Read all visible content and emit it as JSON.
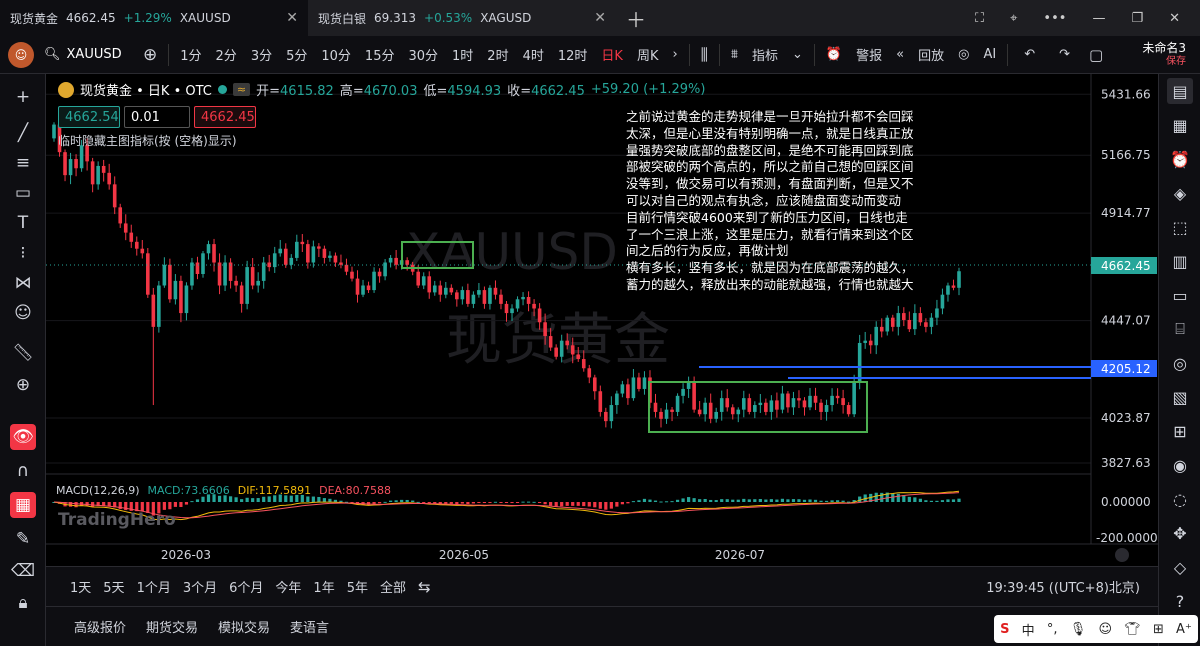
{
  "tabs": [
    {
      "title": "现货黄金",
      "price": "4662.45",
      "change": "+1.29%",
      "symbol": "XAUUSD"
    },
    {
      "title": "现货白银",
      "price": "69.313",
      "change": "+0.53%",
      "symbol": "XAGUSD"
    }
  ],
  "toolbar": {
    "symbol": "XAUUSD",
    "intervals": [
      "1分",
      "2分",
      "3分",
      "5分",
      "10分",
      "15分",
      "30分",
      "1时",
      "2时",
      "4时",
      "12时",
      "日K",
      "周K"
    ],
    "selected_interval": "日K",
    "indicators_label": "指标",
    "alert_label": "警报",
    "replay_label": "回放",
    "ai_label": "AI",
    "layout_name": "未命名3",
    "save_status": "保存"
  },
  "legend": {
    "title": "现货黄金 • 日K • OTC",
    "open_label": "开",
    "open": "4615.82",
    "high_label": "高",
    "high": "4670.03",
    "low_label": "低",
    "low": "4594.93",
    "close_label": "收",
    "close": "4662.45",
    "change": "+59.20 (+1.29%)"
  },
  "trade": {
    "bid": "4662.54",
    "qty": "0.01",
    "ask": "4662.45"
  },
  "hint": "临时隐藏主图指标(按 (空格)显示)",
  "watermark": {
    "symbol": "XAUUSD",
    "name": "现货黄金"
  },
  "note": {
    "p1": "之前说过黄金的走势规律是一旦开始拉升都不会回踩太深，但是心里没有特别明确一点，就是日线真正放量强势突破底部的盘整区间，是绝不可能再回踩到底部被突破的两个高点的，所以之前自己想的回踩区间没等到，做交易可以有预测，有盘面判断，但是又不可以对自己的观点有执念，应该随盘面变动而变动",
    "p2": "目前行情突破4600来到了新的压力区间，日线也走了一个三浪上涨，这里是压力，就看行情来到这个区间之后的行为反应，再做计划",
    "p3": "横有多长，竖有多长，就是因为在底部震荡的越久，蓄力的越久，释放出来的动能就越强，行情也就越大"
  },
  "price_axis": {
    "labels": [
      "5431.66",
      "5166.75",
      "4914.77",
      "4447.07",
      "4023.87",
      "3827.63"
    ],
    "last_price": "4662.45",
    "line_price": "4205.12"
  },
  "macd": {
    "label": "MACD(12,26,9)",
    "macd_label": "MACD:73.6606",
    "dif_label": "DIF:117.5891",
    "dea_label": "DEA:80.7588",
    "axis": [
      "0.00000",
      "-200.00000"
    ]
  },
  "time_axis": [
    "2026-03",
    "2026-05",
    "2026-07"
  ],
  "brand": "TradingHero",
  "ranges": [
    "1天",
    "5天",
    "1个月",
    "3个月",
    "6个月",
    "今年",
    "1年",
    "5年",
    "全部"
  ],
  "clock": "19:39:45 ((UTC+8)北京)",
  "panels": [
    "高级报价",
    "期货交易",
    "模拟交易",
    "麦语言"
  ],
  "ime": {
    "logo": "S",
    "lang": "中"
  },
  "colors": {
    "up": "#26a69a",
    "down": "#f23645",
    "box": "#4caf50",
    "hline": "#2962ff",
    "accent": "#f23645"
  },
  "chart_data": {
    "type": "candlestick",
    "y_range": [
      3780,
      5520
    ],
    "closes": [
      5300,
      5180,
      5080,
      5150,
      5110,
      5210,
      5140,
      5040,
      5120,
      5090,
      5040,
      4940,
      4870,
      4830,
      4790,
      4760,
      4740,
      4560,
      4420,
      4600,
      4690,
      4540,
      4620,
      4480,
      4600,
      4700,
      4650,
      4740,
      4780,
      4700,
      4600,
      4700,
      4620,
      4600,
      4520,
      4680,
      4600,
      4620,
      4700,
      4680,
      4740,
      4760,
      4690,
      4720,
      4790,
      4780,
      4700,
      4770,
      4760,
      4720,
      4730,
      4700,
      4690,
      4660,
      4630,
      4560,
      4600,
      4580,
      4660,
      4640,
      4700,
      4720,
      4690,
      4710,
      4690,
      4660,
      4600,
      4640,
      4570,
      4600,
      4560,
      4590,
      4570,
      4540,
      4580,
      4520,
      4560,
      4580,
      4520,
      4590,
      4560,
      4520,
      4480,
      4500,
      4540,
      4550,
      4520,
      4500,
      4440,
      4380,
      4330,
      4290,
      4360,
      4340,
      4300,
      4280,
      4240,
      4200,
      4140,
      4050,
      4010,
      4080,
      4130,
      4170,
      4110,
      4200,
      4150,
      4200,
      4090,
      4050,
      4020,
      4060,
      4050,
      4120,
      4150,
      4180,
      4060,
      4040,
      4090,
      4020,
      4050,
      4110,
      4070,
      4040,
      4060,
      4110,
      4050,
      4080,
      4090,
      4050,
      4100,
      4060,
      4130,
      4070,
      4110,
      4100,
      4070,
      4120,
      4090,
      4050,
      4080,
      4120,
      4110,
      4080,
      4040,
      4180,
      4350,
      4360,
      4340,
      4420,
      4400,
      4460,
      4420,
      4480,
      4450,
      4410,
      4480,
      4440,
      4420,
      4460,
      4500,
      4560,
      4600,
      4590,
      4662
    ]
  }
}
